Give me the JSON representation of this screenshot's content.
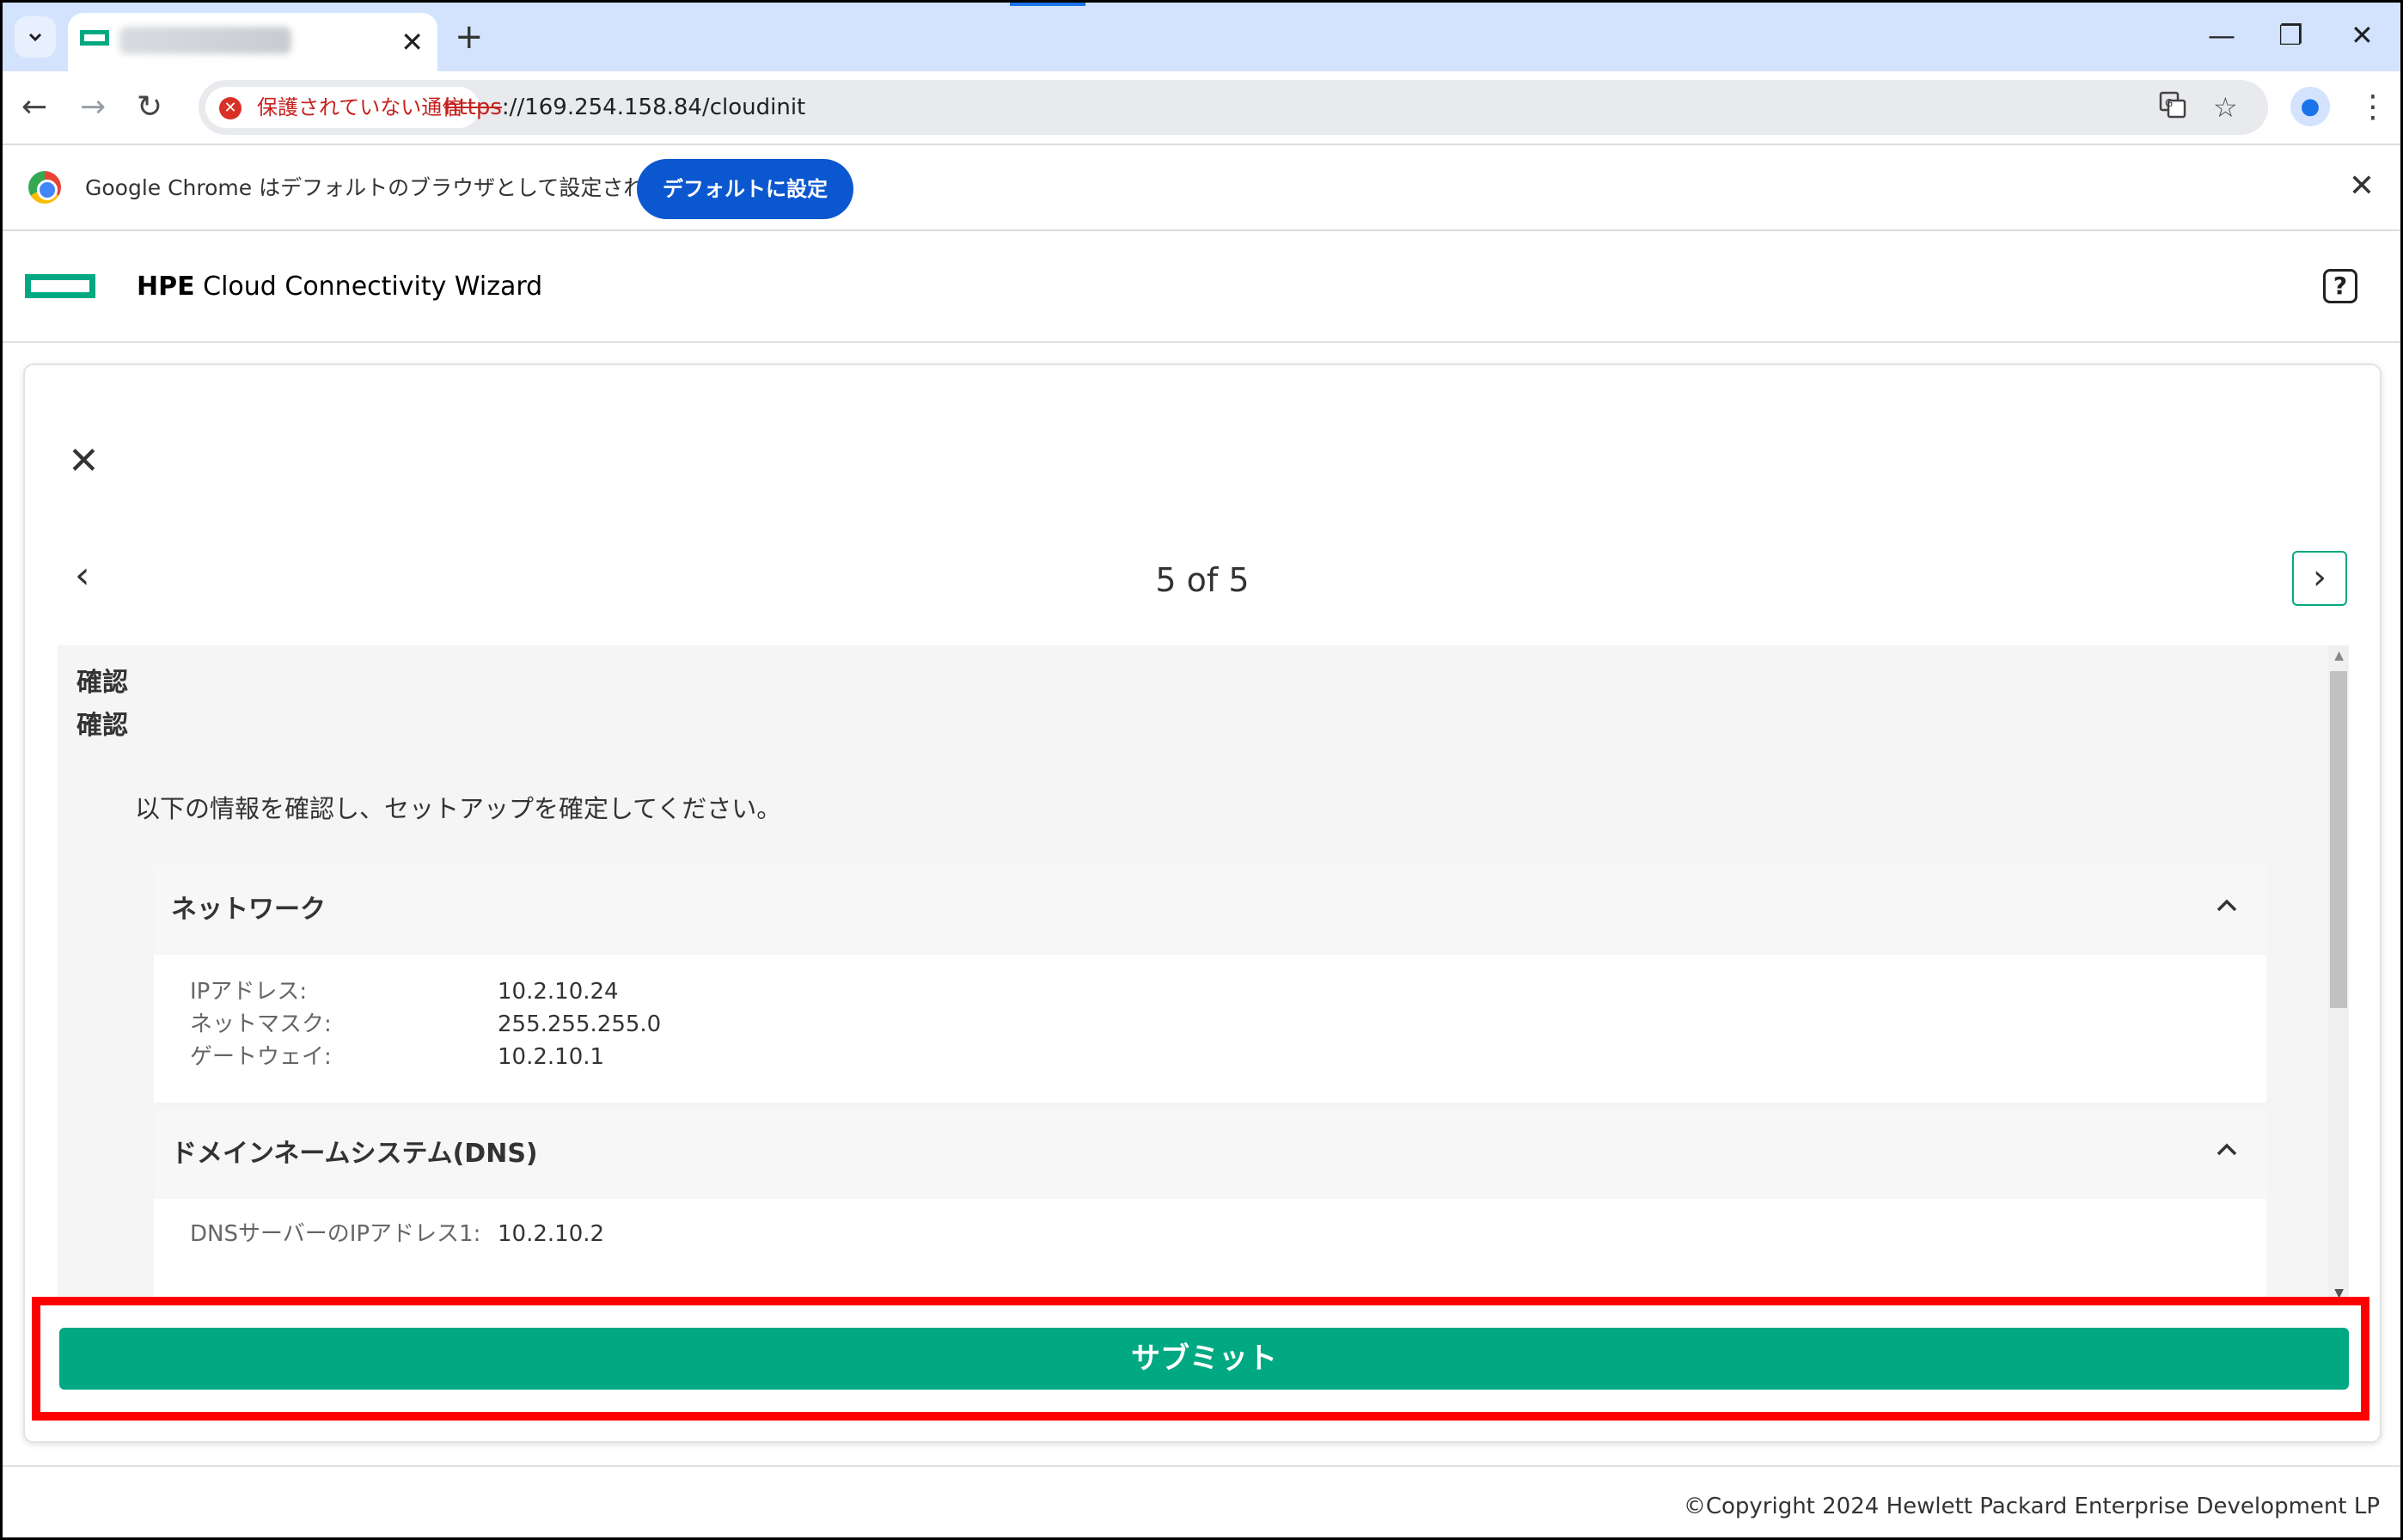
{
  "browser": {
    "tab_close": "✕",
    "new_tab": "+",
    "security_chip": "保護されていない通信",
    "url_scheme": "https",
    "url_rest": "://169.254.158.84/cloudinit",
    "window": {
      "minimize": "—",
      "restore": "❐",
      "close": "✕"
    }
  },
  "infobar": {
    "message": "Google Chrome はデフォルトのブラウザとして設定されていません",
    "set_default_label": "デフォルトに設定"
  },
  "app": {
    "brand": "HPE",
    "title": "Cloud Connectivity Wizard",
    "help": "?"
  },
  "wizard": {
    "step_label": "5 of 5",
    "heading_1": "確認",
    "heading_2": "確認",
    "intro": "以下の情報を確認し、セットアップを確定してください。",
    "sections": [
      {
        "title": "ネットワーク",
        "rows": [
          {
            "key": "IPアドレス:",
            "value": "10.2.10.24"
          },
          {
            "key": "ネットマスク:",
            "value": "255.255.255.0"
          },
          {
            "key": "ゲートウェイ:",
            "value": "10.2.10.1"
          }
        ]
      },
      {
        "title": "ドメインネームシステム(DNS)",
        "rows": [
          {
            "key": "DNSサーバーのIPアドレス1:",
            "value": "10.2.10.2"
          }
        ]
      }
    ],
    "submit_label": "サブミット"
  },
  "footer": {
    "copyright": "©Copyright 2024 Hewlett Packard Enterprise Development LP"
  },
  "colors": {
    "accent": "#01a982",
    "highlight": "#ff0000",
    "chrome_blue": "#0b57d0"
  }
}
